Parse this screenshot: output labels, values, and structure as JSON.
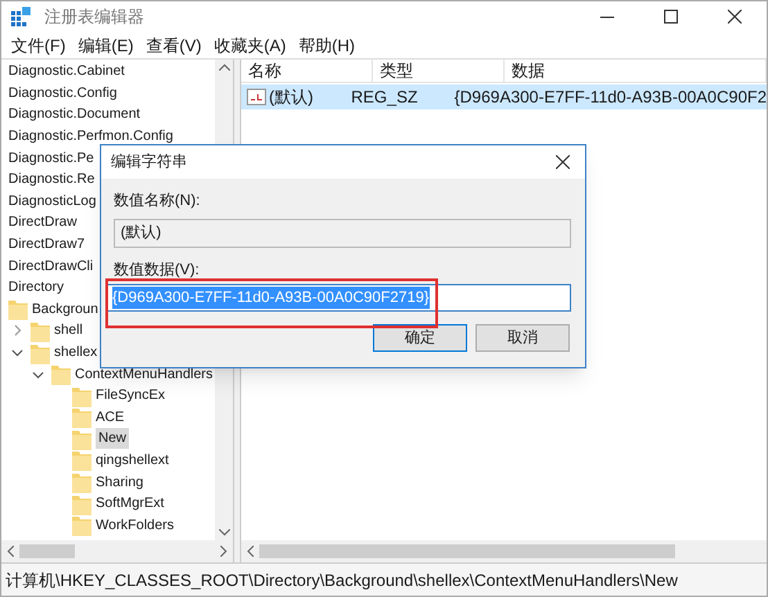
{
  "window": {
    "title": "注册表编辑器"
  },
  "menu": [
    "文件(F)",
    "编辑(E)",
    "查看(V)",
    "收藏夹(A)",
    "帮助(H)"
  ],
  "tree": [
    {
      "label": "Diagnostic.Cabinet",
      "kind": "label",
      "selected": false
    },
    {
      "label": "Diagnostic.Config",
      "kind": "label",
      "selected": false
    },
    {
      "label": "Diagnostic.Document",
      "kind": "label",
      "selected": false
    },
    {
      "label": "Diagnostic.Perfmon.Config",
      "kind": "label",
      "selected": false
    },
    {
      "label": "Diagnostic.Pe",
      "kind": "label",
      "selected": false
    },
    {
      "label": "Diagnostic.Re",
      "kind": "label",
      "selected": false
    },
    {
      "label": "DiagnosticLog",
      "kind": "label",
      "selected": false
    },
    {
      "label": "DirectDraw",
      "kind": "label",
      "selected": false
    },
    {
      "label": "DirectDraw7",
      "kind": "label",
      "selected": false
    },
    {
      "label": "DirectDrawCli",
      "kind": "label",
      "selected": false
    },
    {
      "label": "Directory",
      "kind": "label",
      "selected": false
    },
    {
      "label": "Backgroun",
      "kind": "folder",
      "selected": false,
      "children": [
        {
          "label": "shell",
          "kind": "folder",
          "selected": false,
          "expanded": false
        },
        {
          "label": "shellex",
          "kind": "folder",
          "selected": false,
          "expanded": true,
          "children": [
            {
              "label": "ContextMenuHandlers",
              "kind": "folder",
              "selected": false,
              "expanded": true,
              "children": [
                {
                  "label": "FileSyncEx",
                  "kind": "folder",
                  "selected": false
                },
                {
                  "label": "ACE",
                  "kind": "folder",
                  "selected": false
                },
                {
                  "label": "New",
                  "kind": "folder",
                  "selected": true
                },
                {
                  "label": "qingshellext",
                  "kind": "folder",
                  "selected": false
                },
                {
                  "label": "Sharing",
                  "kind": "folder",
                  "selected": false
                },
                {
                  "label": "SoftMgrExt",
                  "kind": "folder",
                  "selected": false
                },
                {
                  "label": "WorkFolders",
                  "kind": "folder",
                  "selected": false
                }
              ]
            }
          ]
        }
      ]
    }
  ],
  "list": {
    "columns": [
      "名称",
      "类型",
      "数据"
    ],
    "rows": [
      {
        "name": "(默认)",
        "type": "REG_SZ",
        "data": "{D969A300-E7FF-11d0-A93B-00A0C90F2",
        "selected": true
      }
    ]
  },
  "dialog": {
    "title": "编辑字符串",
    "name_label": "数值名称(N):",
    "name_value": "(默认)",
    "data_label": "数值数据(V):",
    "data_value": "{D969A300-E7FF-11d0-A93B-00A0C90F2719}",
    "data_value_selected": true,
    "buttons": [
      {
        "label": "确定",
        "default": true
      },
      {
        "label": "取消",
        "default": false
      }
    ]
  },
  "status_bar": "计算机\\HKEY_CLASSES_ROOT\\Directory\\Background\\shellex\\ContextMenuHandlers\\New"
}
